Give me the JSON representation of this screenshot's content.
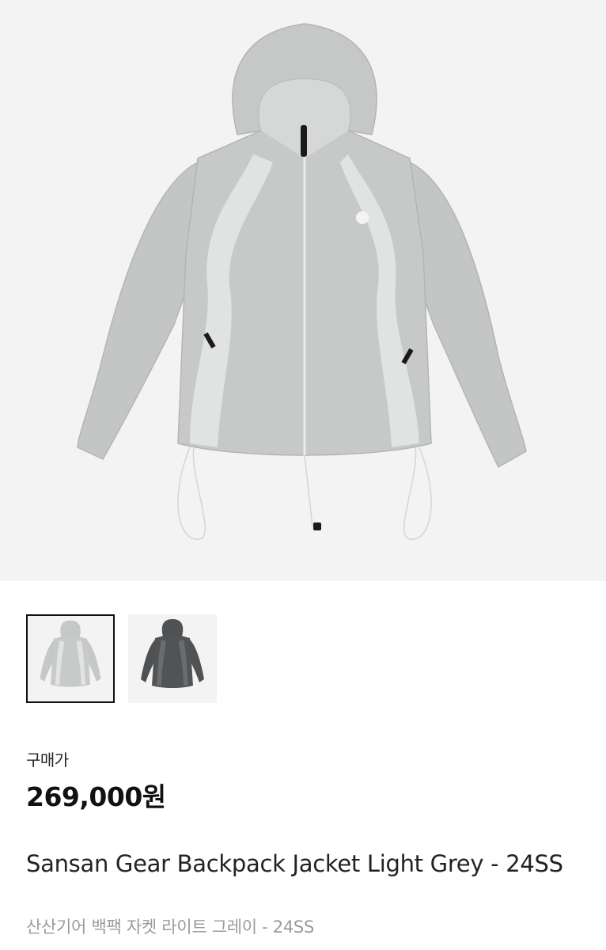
{
  "product": {
    "images": [
      {
        "name": "light-grey",
        "color": "#c6c8c7",
        "accent": "#e2e3e3"
      },
      {
        "name": "dark-grey",
        "color": "#4f5153",
        "accent": "#6a6c6e"
      }
    ],
    "selected_index": 0,
    "price_label": "구매가",
    "price": "269,000원",
    "title": "Sansan Gear Backpack Jacket Light Grey - 24SS",
    "subtitle": "산산기어 백팩 자켓 라이트 그레이 - 24SS"
  }
}
